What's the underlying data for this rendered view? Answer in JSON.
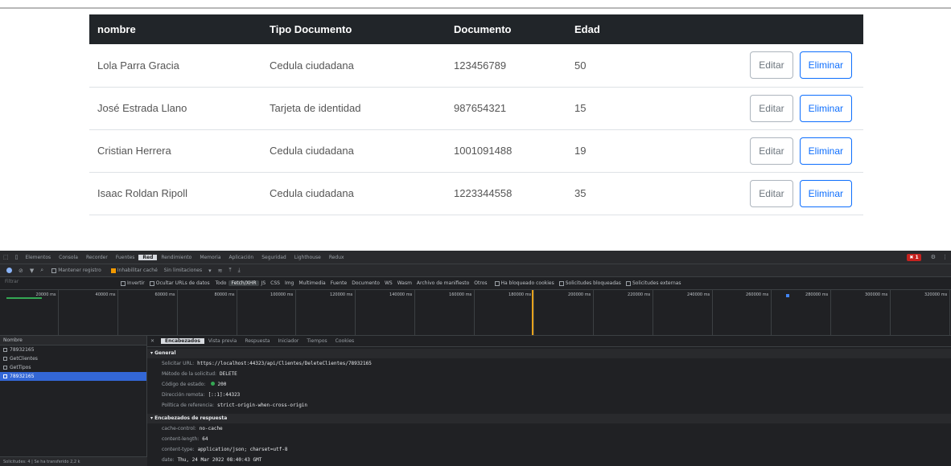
{
  "table": {
    "headers": [
      "nombre",
      "Tipo Documento",
      "Documento",
      "Edad"
    ],
    "rows": [
      {
        "nombre": "Lola Parra Gracia",
        "tipo": "Cedula ciudadana",
        "documento": "123456789",
        "edad": "50"
      },
      {
        "nombre": "José Estrada Llano",
        "tipo": "Tarjeta de identidad",
        "documento": "987654321",
        "edad": "15"
      },
      {
        "nombre": "Cristian Herrera",
        "tipo": "Cedula ciudadana",
        "documento": "1001091488",
        "edad": "19"
      },
      {
        "nombre": "Isaac Roldan Ripoll",
        "tipo": "Cedula ciudadana",
        "documento": "1223344558",
        "edad": "35"
      }
    ],
    "edit_label": "Editar",
    "delete_label": "Eliminar"
  },
  "devtools": {
    "tabs": [
      "Elementos",
      "Consola",
      "Recorder",
      "Fuentes",
      "Red",
      "Rendimiento",
      "Memoria",
      "Aplicación",
      "Seguridad",
      "Lighthouse",
      "Redux"
    ],
    "active_tab": "Red",
    "error_count": "1",
    "toolbar": {
      "preserve_log": "Mantener registro",
      "disable_cache": "Inhabilitar caché",
      "throttling": "Sin limitaciones"
    },
    "filter": {
      "placeholder": "Filtrar",
      "invert": "Invertir",
      "hide_data_urls": "Ocultar URLs de datos",
      "types": [
        "Todo",
        "Fetch/XHR",
        "JS",
        "CSS",
        "Img",
        "Multimedia",
        "Fuente",
        "Documento",
        "WS",
        "Wasm",
        "Archivo de manifiesto",
        "Otros"
      ],
      "active_type": "Fetch/XHR",
      "blocked_cookies": "Ha bloqueado cookies",
      "blocked_requests": "Solicitudes bloqueadas",
      "third_party": "Solicitudes externas"
    },
    "timeline_ticks": [
      "20000 ms",
      "40000 ms",
      "60000 ms",
      "80000 ms",
      "100000 ms",
      "120000 ms",
      "140000 ms",
      "160000 ms",
      "180000 ms",
      "200000 ms",
      "220000 ms",
      "240000 ms",
      "260000 ms",
      "280000 ms",
      "300000 ms",
      "320000 ms"
    ],
    "list": {
      "header": "Nombre",
      "requests": [
        "78932165",
        "GetClientes",
        "GetTipos",
        "78932165"
      ],
      "selected_index": 3,
      "footer": "Solicitudes: 4 | Se ha transferido 2,2 k"
    },
    "detail": {
      "tabs": [
        "Encabezados",
        "Vista previa",
        "Respuesta",
        "Iniciador",
        "Tiempos",
        "Cookies"
      ],
      "active_tab": "Encabezados",
      "general_title": "General",
      "general": [
        {
          "k": "Solicitar URL:",
          "v": "https://localhost:44323/api/Clientes/DeleteClientes/78932165"
        },
        {
          "k": "Método de la solicitud:",
          "v": "DELETE"
        },
        {
          "k": "Código de estado:",
          "v": "200"
        },
        {
          "k": "Dirección remota:",
          "v": "[::1]:44323"
        },
        {
          "k": "Política de referencia:",
          "v": "strict-origin-when-cross-origin"
        }
      ],
      "response_title": "Encabezados de respuesta",
      "response": [
        {
          "k": "cache-control:",
          "v": "no-cache"
        },
        {
          "k": "content-length:",
          "v": "64"
        },
        {
          "k": "content-type:",
          "v": "application/json; charset=utf-8"
        },
        {
          "k": "date:",
          "v": "Thu, 24 Mar 2022 08:40:43 GMT"
        }
      ]
    }
  }
}
